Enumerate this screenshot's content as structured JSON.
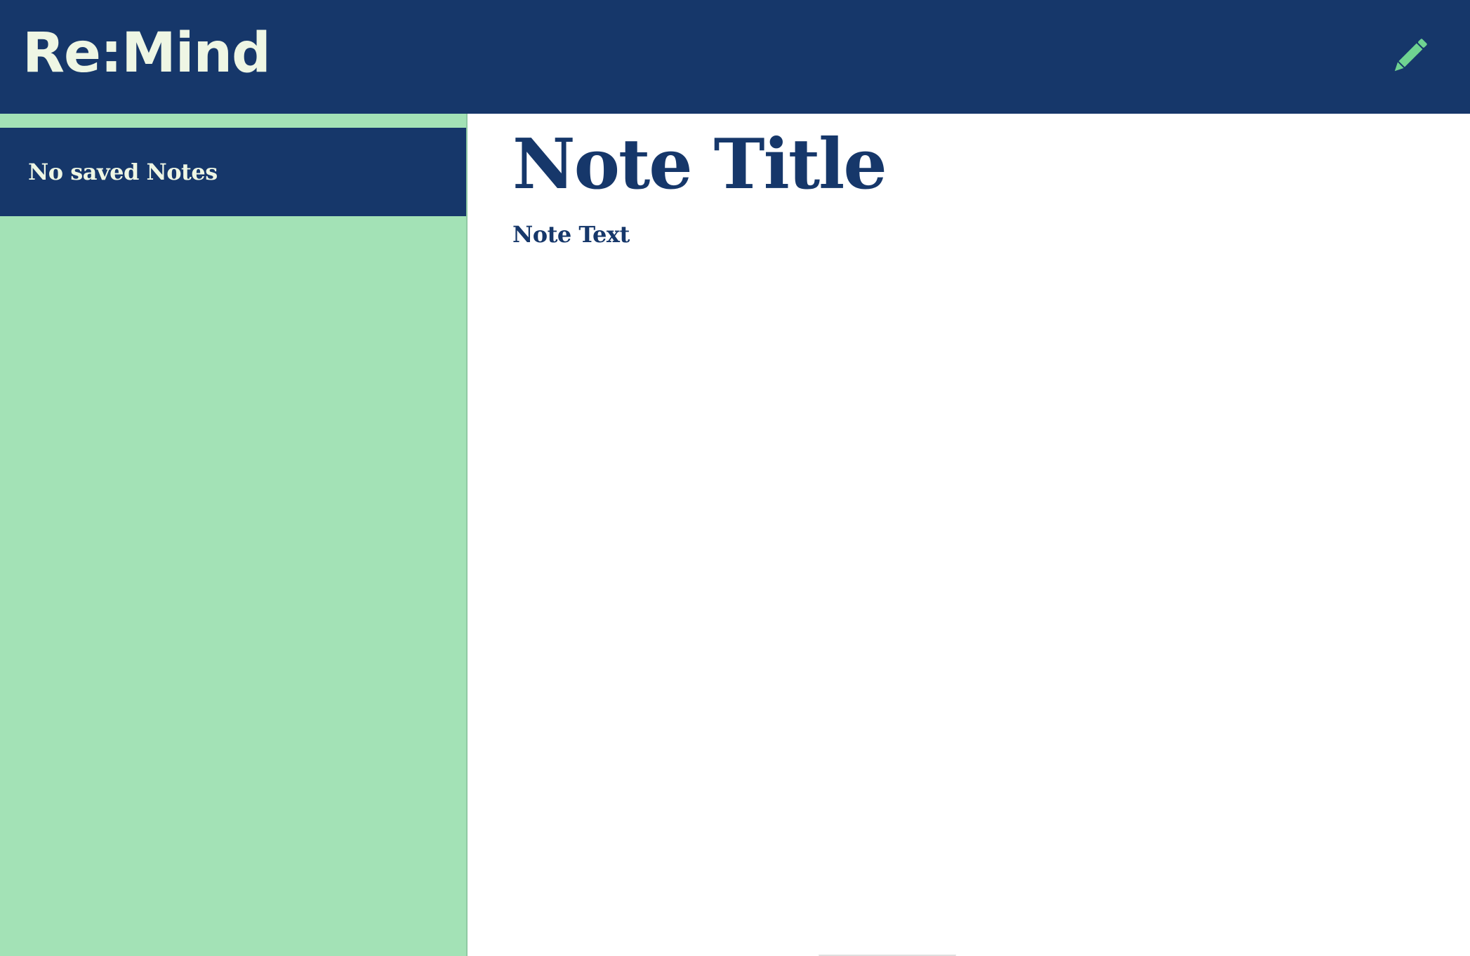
{
  "header": {
    "brand": "Re:Mind",
    "new_note_icon": "pencil-icon"
  },
  "sidebar": {
    "notes": [
      {
        "label": "No saved Notes"
      }
    ]
  },
  "main": {
    "title_placeholder": "Note Title",
    "text_placeholder": "Note Text"
  },
  "colors": {
    "navy": "#16376a",
    "mint": "#a3e2b6",
    "cream": "#eef6e4",
    "pencil_green": "#6fd391"
  }
}
